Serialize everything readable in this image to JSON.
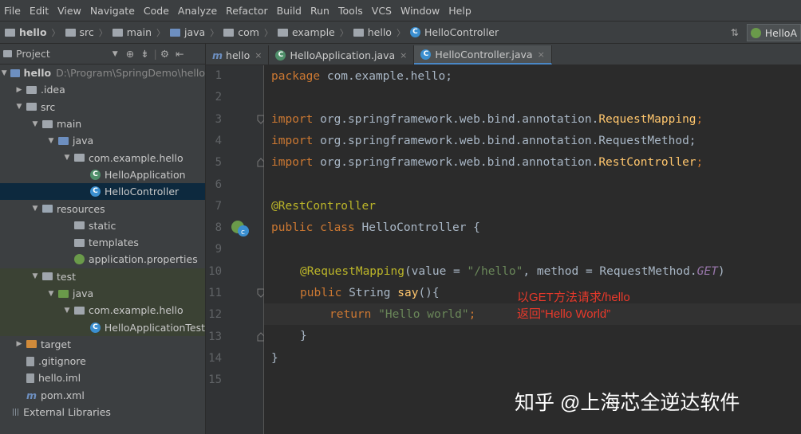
{
  "menu": [
    "File",
    "Edit",
    "View",
    "Navigate",
    "Code",
    "Analyze",
    "Refactor",
    "Build",
    "Run",
    "Tools",
    "VCS",
    "Window",
    "Help"
  ],
  "breadcrumbs": [
    "hello",
    "src",
    "main",
    "java",
    "com",
    "example",
    "hello",
    "HelloController"
  ],
  "run_config": "HelloA",
  "project_panel": {
    "title": "Project"
  },
  "tree": [
    {
      "label": "hello",
      "extra": "D:\\Program\\SpringDemo\\hello",
      "indent": 0,
      "arrow": "▼",
      "icon": "module"
    },
    {
      "label": ".idea",
      "indent": 1,
      "arrow": "▶",
      "icon": "folder"
    },
    {
      "label": "src",
      "indent": 1,
      "arrow": "▼",
      "icon": "folder"
    },
    {
      "label": "main",
      "indent": 2,
      "arrow": "▼",
      "icon": "folder"
    },
    {
      "label": "java",
      "indent": 3,
      "arrow": "▼",
      "icon": "folder-blue"
    },
    {
      "label": "com.example.hello",
      "indent": 4,
      "arrow": "▼",
      "icon": "package"
    },
    {
      "label": "HelloApplication",
      "indent": 5,
      "arrow": "",
      "icon": "spring-class"
    },
    {
      "label": "HelloController",
      "indent": 5,
      "arrow": "",
      "icon": "class",
      "selected": true
    },
    {
      "label": "resources",
      "indent": 2,
      "arrow": "▼",
      "icon": "folder-res"
    },
    {
      "label": "static",
      "indent": 4,
      "arrow": "",
      "icon": "folder"
    },
    {
      "label": "templates",
      "indent": 4,
      "arrow": "",
      "icon": "folder"
    },
    {
      "label": "application.properties",
      "indent": 4,
      "arrow": "",
      "icon": "spring"
    },
    {
      "label": "test",
      "indent": 2,
      "arrow": "▼",
      "icon": "folder",
      "test": true
    },
    {
      "label": "java",
      "indent": 3,
      "arrow": "▼",
      "icon": "folder-green",
      "test": true
    },
    {
      "label": "com.example.hello",
      "indent": 4,
      "arrow": "▼",
      "icon": "package",
      "test": true
    },
    {
      "label": "HelloApplicationTest",
      "indent": 5,
      "arrow": "",
      "icon": "class",
      "test": true
    },
    {
      "label": "target",
      "indent": 1,
      "arrow": "▶",
      "icon": "folder-orange"
    },
    {
      "label": ".gitignore",
      "indent": 1,
      "arrow": "",
      "icon": "file"
    },
    {
      "label": "hello.iml",
      "indent": 1,
      "arrow": "",
      "icon": "file"
    },
    {
      "label": "pom.xml",
      "indent": 1,
      "arrow": "",
      "icon": "maven"
    },
    {
      "label": "External Libraries",
      "indent": 0,
      "arrow": "",
      "icon": "libs"
    }
  ],
  "tabs": [
    {
      "label": "hello",
      "active": false
    },
    {
      "label": "HelloApplication.java",
      "active": false
    },
    {
      "label": "HelloController.java",
      "active": true
    }
  ],
  "code_lines": [
    {
      "n": "1"
    },
    {
      "n": "2"
    },
    {
      "n": "3"
    },
    {
      "n": "4"
    },
    {
      "n": "5"
    },
    {
      "n": "6"
    },
    {
      "n": "7"
    },
    {
      "n": "8"
    },
    {
      "n": "9"
    },
    {
      "n": "10"
    },
    {
      "n": "11"
    },
    {
      "n": "12"
    },
    {
      "n": "13"
    },
    {
      "n": "14"
    },
    {
      "n": "15"
    }
  ],
  "code": {
    "l1_kw": "package",
    "l1_rest": " com.example.hello;",
    "l3_kw": "import",
    "l3_rest": " org.springframework.web.bind.annotation.",
    "l3_cls": "RequestMapping",
    "l3_end": ";",
    "l4_kw": "import",
    "l4_rest": " org.springframework.web.bind.annotation.RequestMethod;",
    "l5_kw": "import",
    "l5_rest": " org.springframework.web.bind.annotation.",
    "l5_cls": "RestController",
    "l5_end": ";",
    "l7_ann": "@RestController",
    "l8_kw": "public class",
    "l8_rest": " HelloController {",
    "l10_ann": "@RequestMapping",
    "l10_a": "(value = ",
    "l10_str": "\"/hello\"",
    "l10_b": ", method = RequestMethod.",
    "l10_fld": "GET",
    "l10_c": ")",
    "l11_kw": "public",
    "l11_a": " String ",
    "l11_fn": "say",
    "l11_b": "(){",
    "l12_kw": "return",
    "l12_str": " \"Hello world\"",
    "l12_end": ";",
    "l13": "}",
    "l14": "}"
  },
  "annotation_note": [
    "以GET方法请求/hello",
    "返回“Hello World”"
  ],
  "watermark": "知乎 @上海芯全逆达软件"
}
